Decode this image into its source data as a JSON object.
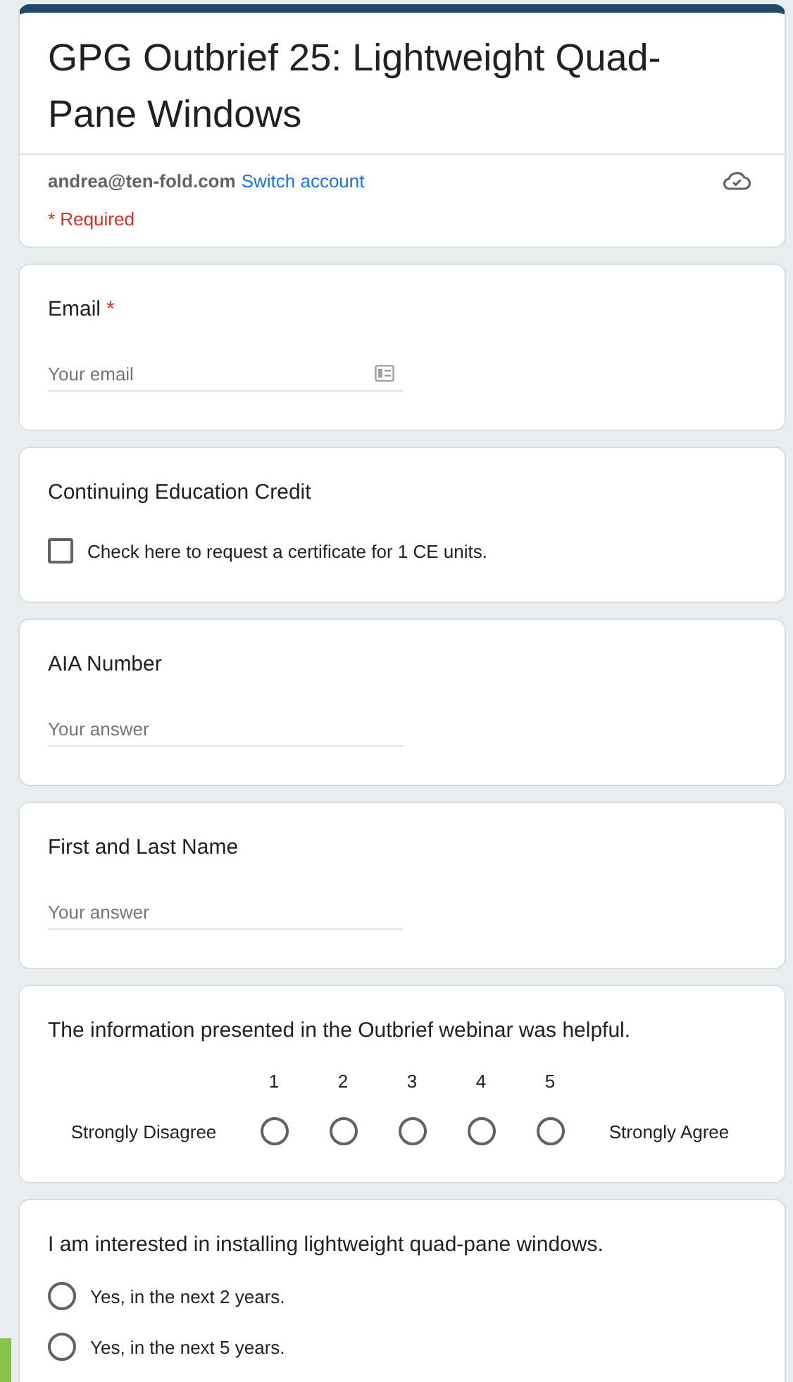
{
  "header": {
    "title": "GPG Outbrief 25: Lightweight Quad-Pane Windows",
    "account_email": "andrea@ten-fold.com",
    "switch_link": "Switch account",
    "required_note": "* Required"
  },
  "questions": [
    {
      "kind": "text",
      "label": "Email",
      "required_mark": "*",
      "placeholder": "Your email",
      "contact_icon": true
    },
    {
      "kind": "checkbox",
      "label": "Continuing Education Credit",
      "options": [
        {
          "label": "Check here to request a certificate for 1 CE units.",
          "checked": false
        }
      ]
    },
    {
      "kind": "text",
      "label": "AIA Number",
      "placeholder": "Your answer"
    },
    {
      "kind": "text",
      "label": "First and Last Name",
      "placeholder": "Your answer"
    },
    {
      "kind": "scale",
      "label": "The information presented in the Outbrief webinar was helpful.",
      "low_label": "Strongly Disagree",
      "high_label": "Strongly Agree",
      "points": [
        {
          "label": "1",
          "selected": false
        },
        {
          "label": "2",
          "selected": false
        },
        {
          "label": "3",
          "selected": false
        },
        {
          "label": "4",
          "selected": false
        },
        {
          "label": "5",
          "selected": false
        }
      ]
    },
    {
      "kind": "radio",
      "label": "I am interested in installing lightweight quad-pane windows.",
      "options": [
        {
          "label": "Yes, in the next 2 years.",
          "selected": false
        },
        {
          "label": "Yes, in the next 5 years.",
          "selected": false
        }
      ]
    }
  ]
}
